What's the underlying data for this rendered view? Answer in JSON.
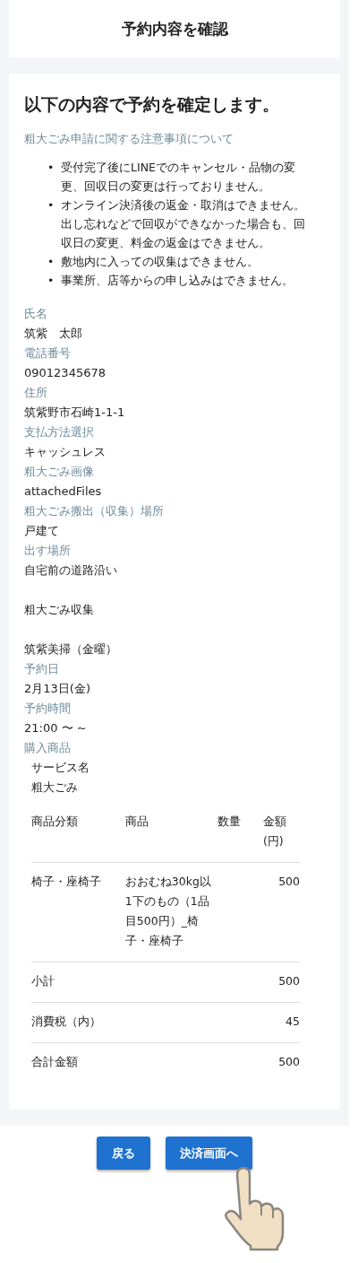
{
  "header": {
    "title": "予約内容を確認"
  },
  "confirm": {
    "heading": "以下の内容で予約を確定します。",
    "notice_title": "粗大ごみ申請に関する注意事項について",
    "notices": [
      {
        "bullet": "•",
        "text": "受付完了後にLINEでのキャンセル・品物の変更、回収日の変更は行っておりません。"
      },
      {
        "bullet": "•",
        "text": "オンライン決済後の返金・取消はできません。出し忘れなどで回収ができなかった場合も、回収日の変更、料金の返金はできません。"
      },
      {
        "bullet": "•",
        "text": "敷地内に入っての収集はできません。"
      },
      {
        "bullet": "•",
        "text": "事業所、店等からの申し込みはできません。"
      }
    ],
    "fields": [
      {
        "kind": "field",
        "label": "氏名",
        "value": "筑紫　太郎"
      },
      {
        "kind": "field",
        "label": "電話番号",
        "value": "09012345678"
      },
      {
        "kind": "field",
        "label": "住所",
        "value": "筑紫野市石崎1-1-1"
      },
      {
        "kind": "field",
        "label": "支払方法選択",
        "value": "キャッシュレス"
      },
      {
        "kind": "field",
        "label": "粗大ごみ画像",
        "value": "attachedFiles"
      },
      {
        "kind": "field",
        "label": "粗大ごみ搬出（収集）場所",
        "value": "戸建て"
      },
      {
        "kind": "field",
        "label": "出す場所",
        "value": "自宅前の道路沿い"
      },
      {
        "kind": "plain",
        "value": "粗大ごみ収集"
      },
      {
        "kind": "plain",
        "value": "筑紫美掃（金曜）"
      },
      {
        "kind": "field",
        "label": "予約日",
        "value": "2月13日(金)"
      },
      {
        "kind": "field",
        "label": "予約時間",
        "value": "21:00 〜 ~"
      },
      {
        "kind": "label",
        "label": "購入商品"
      }
    ],
    "service_label": "サービス名",
    "service_name": "粗大ごみ",
    "table": {
      "columns": [
        "商品分類",
        "商品",
        "数量",
        "金額(円)"
      ],
      "rows": [
        {
          "kind": "item",
          "cells": [
            "椅子・座椅子",
            "おおむね30kg以1下のもの（1品目500円）_椅子・座椅子",
            "",
            "500"
          ]
        },
        {
          "kind": "total",
          "cells": [
            "小計",
            "",
            "",
            "500"
          ]
        },
        {
          "kind": "total",
          "cells": [
            "消費税（内）",
            "",
            "",
            "45"
          ]
        },
        {
          "kind": "total",
          "cells": [
            "合計金額",
            "",
            "",
            "500"
          ]
        }
      ]
    }
  },
  "buttons": [
    {
      "label": "戻る"
    },
    {
      "label": "決済画面へ"
    }
  ]
}
